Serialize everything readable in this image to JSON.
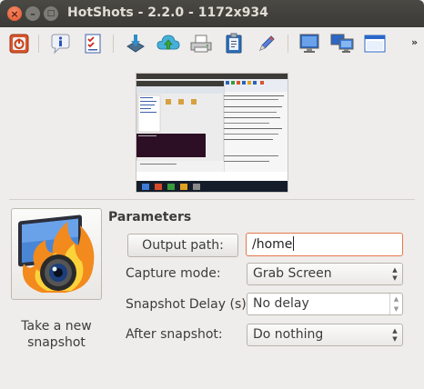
{
  "window": {
    "title": "HotShots - 2.2.0 - 1172x934",
    "close_glyph": "×",
    "min_glyph": "–",
    "max_glyph": "□"
  },
  "toolbar": {
    "items": [
      {
        "icon": "power-icon"
      },
      {
        "icon": "info-icon"
      },
      {
        "icon": "checklist-icon"
      },
      {
        "icon": "import-icon"
      },
      {
        "icon": "upload-cloud-icon"
      },
      {
        "icon": "printer-icon"
      },
      {
        "icon": "clipboard-icon"
      },
      {
        "icon": "pencil-icon"
      },
      {
        "icon": "monitor-icon"
      },
      {
        "icon": "multi-monitor-icon"
      },
      {
        "icon": "window-icon"
      }
    ],
    "overflow": "»"
  },
  "snapshot": {
    "button_label": "Take a new snapshot",
    "icon": "hotshots-camera-flame-icon"
  },
  "parameters": {
    "heading": "Parameters",
    "output_path_button": "Output path:",
    "output_path_value": "/home",
    "capture_mode_label": "Capture mode:",
    "capture_mode_value": "Grab Screen",
    "delay_label": "Snapshot Delay (s):",
    "delay_value": "No delay",
    "after_label": "After snapshot:",
    "after_value": "Do nothing"
  },
  "colors": {
    "titlebar": "#3d3c38",
    "close_button": "#e95420",
    "focus_border": "#e4784a"
  }
}
